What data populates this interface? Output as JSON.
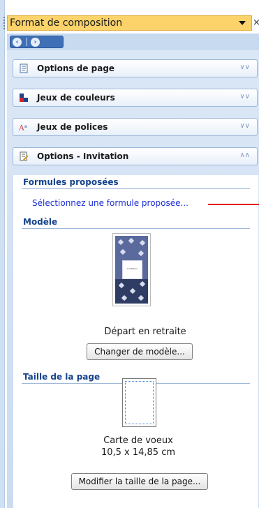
{
  "pane": {
    "title": "Format de composition",
    "close_glyph": "×"
  },
  "nav": {
    "back_icon": "arrow-left-circle",
    "forward_icon": "arrow-right-circle"
  },
  "sections": [
    {
      "label": "Options de page",
      "icon": "page-icon",
      "chevron": "expand"
    },
    {
      "label": "Jeux de couleurs",
      "icon": "color-scheme-icon",
      "chevron": "expand"
    },
    {
      "label": "Jeux de polices",
      "icon": "font-scheme-icon",
      "chevron": "expand"
    },
    {
      "label": "Options - Invitation",
      "icon": "invitation-options-icon",
      "chevron": "collapse"
    }
  ],
  "content": {
    "formules_heading": "Formules proposées",
    "formules_link": "Sélectionnez une formule proposée...",
    "modele_heading": "Modèle",
    "template_caption": "Départ en retraite",
    "template_inner_text": "Invitation",
    "change_template_button": "Changer de modèle...",
    "page_size_heading": "Taille de la page",
    "page_size_name": "Carte de voeux",
    "page_size_dims": "10,5 x 14,85 cm",
    "modify_size_button": "Modifier la taille de la page..."
  },
  "colors": {
    "title_bar": "#fbd36a",
    "heading": "#15428b",
    "link": "#1c2fd6",
    "annotation_line": "#e40000"
  }
}
